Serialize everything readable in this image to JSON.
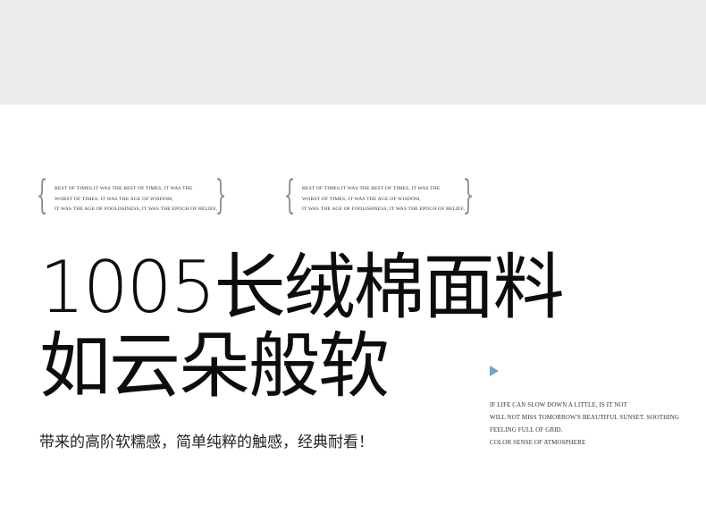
{
  "quote_blocks": [
    {
      "lines": [
        "BEST OF TIMES.IT WAS THE BEST OF TIMES, IT WAS THE",
        "WORST OF TIMES; IT WAS THE AGE OF WISDOM,",
        "IT WAS THE AGE OF FOOLISHNESS; IT WAS THE EPOCH OF BELIEF,"
      ]
    },
    {
      "lines": [
        "BEST OF TIMES.IT WAS THE BEST OF TIMES, IT WAS THE",
        "WORST OF TIMES; IT WAS THE AGE OF WISDOM,",
        "IT WAS THE AGE OF FOOLISHNESS; IT WAS THE EPOCH OF BELIEF,"
      ]
    }
  ],
  "headline": {
    "line1": "1005长绒棉面料",
    "line2": "如云朵般软"
  },
  "subheading": "带来的高阶软糯感，简单纯粹的触感，经典耐看！",
  "side_text": {
    "icon": "play-triangle-icon",
    "icon_color": "#6aa8cc",
    "lines": [
      "IF LIFE CAN SLOW DOWN A LITTLE, IS IT NOT",
      "WILL NOT MISS TOMORROW'S BEAUTIFUL SUNSET. SOOTHING",
      "FEELING FULL OF GRID.",
      "COLOR SENSE OF ATMOSPHERE"
    ]
  },
  "colors": {
    "top_band": "#ebebeb",
    "background": "#ffffff",
    "text": "#111111"
  }
}
